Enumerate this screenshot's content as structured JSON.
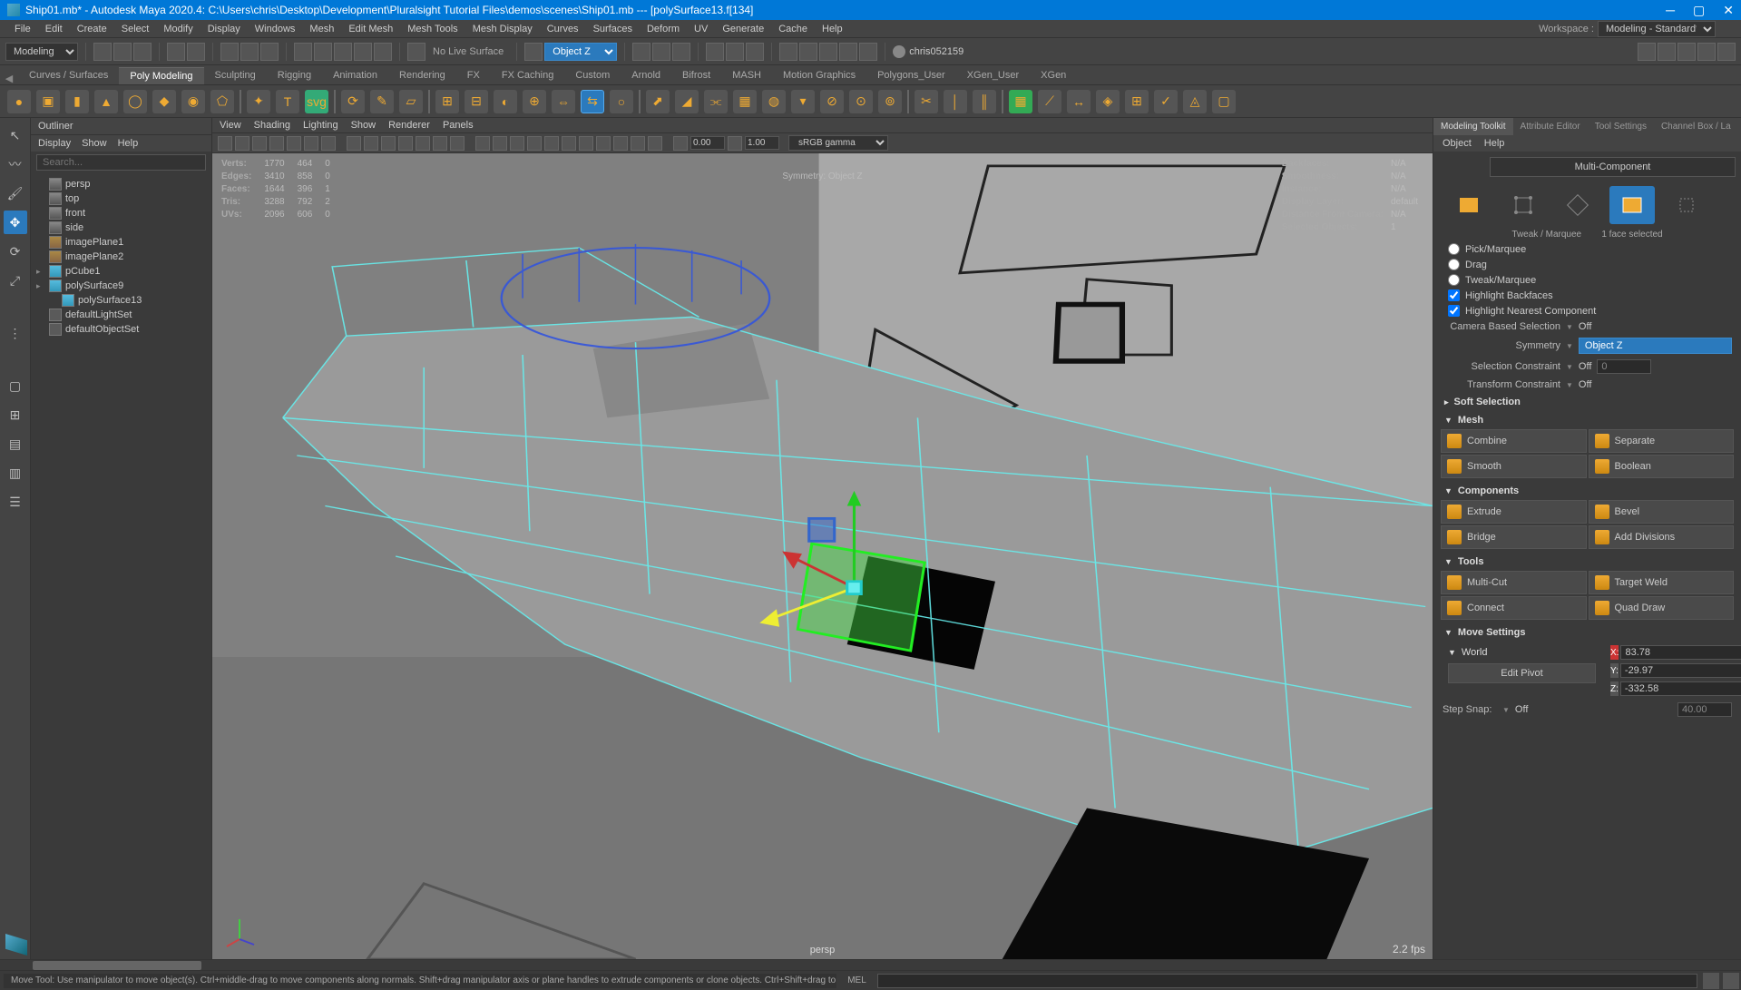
{
  "titlebar": {
    "title": "Ship01.mb* - Autodesk Maya 2020.4: C:\\Users\\chris\\Desktop\\Development\\Pluralsight Tutorial Files\\demos\\scenes\\Ship01.mb  ---  [polySurface13.f[134]"
  },
  "menubar": {
    "items": [
      "File",
      "Edit",
      "Create",
      "Select",
      "Modify",
      "Display",
      "Windows",
      "Mesh",
      "Edit Mesh",
      "Mesh Tools",
      "Mesh Display",
      "Curves",
      "Surfaces",
      "Deform",
      "UV",
      "Generate",
      "Cache",
      "Help"
    ],
    "workspace_label": "Workspace :",
    "workspace_value": "Modeling - Standard*"
  },
  "shelf_top": {
    "mode": "Modeling",
    "live_surface": "No Live Surface",
    "symmetry_axis": "Object Z",
    "username": "chris052159"
  },
  "shelf_tabs": [
    "Curves / Surfaces",
    "Poly Modeling",
    "Sculpting",
    "Rigging",
    "Animation",
    "Rendering",
    "FX",
    "FX Caching",
    "Custom",
    "Arnold",
    "Bifrost",
    "MASH",
    "Motion Graphics",
    "Polygons_User",
    "XGen_User",
    "XGen"
  ],
  "shelf_active_tab_idx": 1,
  "outliner": {
    "title": "Outliner",
    "menus": [
      "Display",
      "Show",
      "Help"
    ],
    "search_placeholder": "Search...",
    "nodes": [
      {
        "type": "cam",
        "label": "persp",
        "indent": 0,
        "exp": ""
      },
      {
        "type": "cam",
        "label": "top",
        "indent": 0,
        "exp": ""
      },
      {
        "type": "cam",
        "label": "front",
        "indent": 0,
        "exp": ""
      },
      {
        "type": "cam",
        "label": "side",
        "indent": 0,
        "exp": ""
      },
      {
        "type": "img",
        "label": "imagePlane1",
        "indent": 0,
        "exp": ""
      },
      {
        "type": "img",
        "label": "imagePlane2",
        "indent": 0,
        "exp": ""
      },
      {
        "type": "mesh",
        "label": "pCube1",
        "indent": 0,
        "exp": "▸"
      },
      {
        "type": "mesh",
        "label": "polySurface9",
        "indent": 0,
        "exp": "▸"
      },
      {
        "type": "mesh",
        "label": "polySurface13",
        "indent": 1,
        "exp": ""
      },
      {
        "type": "set",
        "label": "defaultLightSet",
        "indent": 0,
        "exp": ""
      },
      {
        "type": "set",
        "label": "defaultObjectSet",
        "indent": 0,
        "exp": ""
      }
    ]
  },
  "viewport": {
    "menus": [
      "View",
      "Shading",
      "Lighting",
      "Show",
      "Renderer",
      "Panels"
    ],
    "near_clip": "0.00",
    "far_clip": "1.00",
    "color_mgmt": "sRGB gamma",
    "camera_name": "persp",
    "fps": "2.2 fps",
    "symmetry_text": "Symmetry: Object Z",
    "stats": {
      "rows": [
        {
          "label": "Verts:",
          "c1": "1770",
          "c2": "464",
          "c3": "0"
        },
        {
          "label": "Edges:",
          "c1": "3410",
          "c2": "858",
          "c3": "0"
        },
        {
          "label": "Faces:",
          "c1": "1644",
          "c2": "396",
          "c3": "1"
        },
        {
          "label": "Tris:",
          "c1": "3288",
          "c2": "792",
          "c3": "2"
        },
        {
          "label": "UVs:",
          "c1": "2096",
          "c2": "606",
          "c3": "0"
        }
      ]
    },
    "info": {
      "rows": [
        {
          "label": "Backfaces:",
          "val": "N/A"
        },
        {
          "label": "Smoothness:",
          "val": "N/A"
        },
        {
          "label": "Instance:",
          "val": "N/A"
        },
        {
          "label": "Display Layer:",
          "val": "default"
        },
        {
          "label": "Distance From Camera:",
          "val": "N/A"
        },
        {
          "label": "Selected Objects:",
          "val": "1"
        }
      ]
    }
  },
  "mtk": {
    "tabs": [
      "Modeling Toolkit",
      "Attribute Editor",
      "Tool Settings",
      "Channel Box / La"
    ],
    "menus": [
      "Object",
      "Help"
    ],
    "multi_component": "Multi-Component",
    "tweak_label": "Tweak / Marquee",
    "selection_count": "1 face selected",
    "sel_radios": [
      "Pick/Marquee",
      "Drag",
      "Tweak/Marquee"
    ],
    "sel_checks": [
      "Highlight Backfaces",
      "Highlight Nearest Component"
    ],
    "camera_based_label": "Camera Based Selection",
    "camera_based_val": "Off",
    "symmetry_label": "Symmetry",
    "symmetry_val": "Object Z",
    "sel_constraint_label": "Selection Constraint",
    "sel_constraint_val": "Off",
    "sel_constraint_num": "0",
    "xform_constraint_label": "Transform Constraint",
    "xform_constraint_val": "Off",
    "soft_sel": "Soft Selection",
    "sections": {
      "mesh": {
        "title": "Mesh",
        "btns": [
          "Combine",
          "Separate",
          "Smooth",
          "Boolean"
        ]
      },
      "components": {
        "title": "Components",
        "btns": [
          "Extrude",
          "Bevel",
          "Bridge",
          "Add Divisions"
        ]
      },
      "tools": {
        "title": "Tools",
        "btns": [
          "Multi-Cut",
          "Target Weld",
          "Connect",
          "Quad Draw"
        ]
      }
    },
    "move_settings": "Move Settings",
    "world_label": "World",
    "x": "83.78",
    "y": "-29.97",
    "z": "-332.58",
    "edit_pivot": "Edit Pivot",
    "step_snap_label": "Step Snap:",
    "step_snap_val": "Off",
    "step_snap_num": "40.00"
  },
  "status": {
    "help": "Move Tool: Use manipulator to move object(s). Ctrl+middle-drag to move components along normals. Shift+drag manipulator axis or plane handles to extrude components or clone objects. Ctrl+Shift+drag to constra",
    "cmd_label": "MEL"
  }
}
